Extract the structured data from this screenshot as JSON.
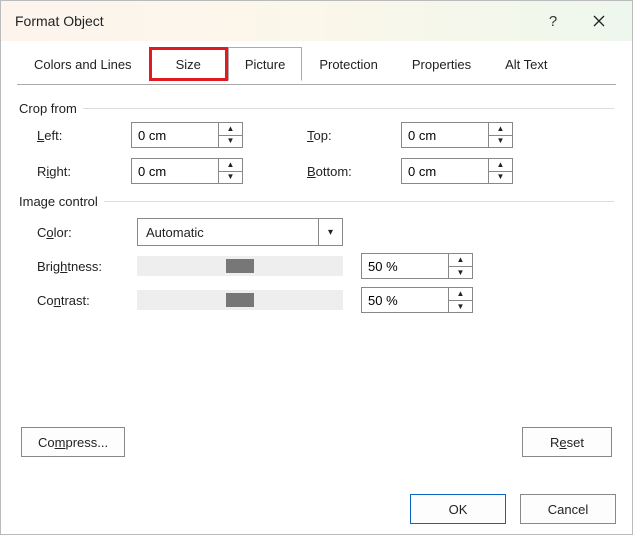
{
  "title": "Format Object",
  "tabs": {
    "colors": "Colors and Lines",
    "size": "Size",
    "picture": "Picture",
    "protection": "Protection",
    "properties": "Properties",
    "alttext": "Alt Text"
  },
  "crop": {
    "group_label": "Crop from",
    "left_label": "Left:",
    "right_label": "Right:",
    "top_label": "Top:",
    "bottom_label": "Bottom:",
    "left_val": "0 cm",
    "right_val": "0 cm",
    "top_val": "0 cm",
    "bottom_val": "0 cm"
  },
  "image": {
    "group_label": "Image control",
    "color_label": "Color:",
    "color_val": "Automatic",
    "brightness_label": "Brightness:",
    "contrast_label": "Contrast:",
    "brightness_val": "50 %",
    "contrast_val": "50 %"
  },
  "buttons": {
    "compress": "Compress...",
    "reset": "Reset",
    "ok": "OK",
    "cancel": "Cancel"
  }
}
